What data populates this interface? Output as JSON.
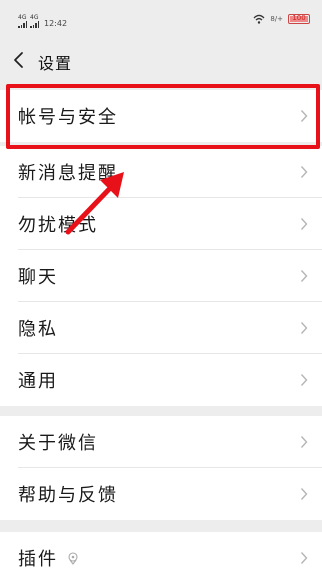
{
  "status_bar": {
    "signal_1": "4G",
    "signal_2": "4G",
    "time": "12:42",
    "extra": "8/+",
    "battery": "100"
  },
  "nav": {
    "title": "设置"
  },
  "rows": [
    {
      "label": "帐号与安全"
    },
    {
      "label": "新消息提醒"
    },
    {
      "label": "勿扰模式"
    },
    {
      "label": "聊天"
    },
    {
      "label": "隐私"
    },
    {
      "label": "通用"
    },
    {
      "label": "关于微信"
    },
    {
      "label": "帮助与反馈"
    },
    {
      "label": "插件"
    }
  ],
  "colors": {
    "highlight": "#e8111a",
    "background": "#ededed"
  }
}
